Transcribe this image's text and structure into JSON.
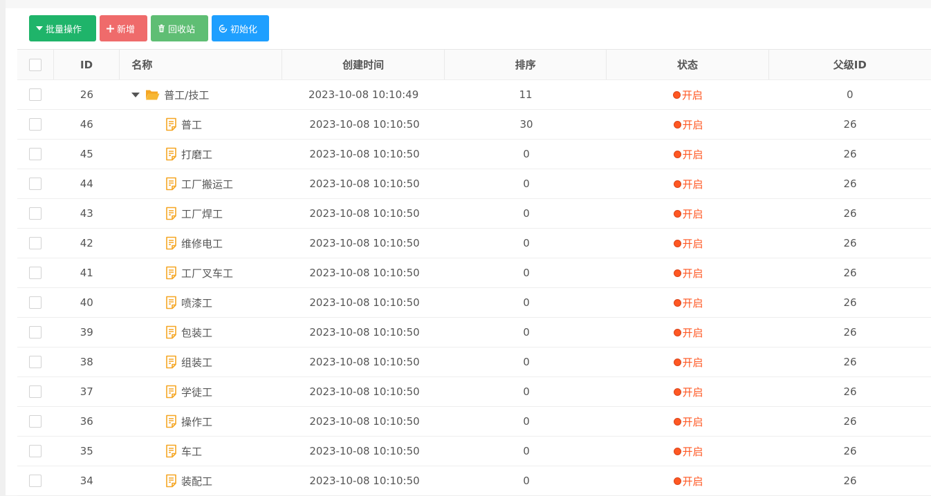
{
  "toolbar": {
    "batch_label": "批量操作",
    "add_label": "新增",
    "recycle_label": "回收站",
    "init_label": "初始化"
  },
  "table": {
    "headers": {
      "id": "ID",
      "name": "名称",
      "time": "创建时间",
      "sort": "排序",
      "status": "状态",
      "pid": "父级ID"
    },
    "rows": [
      {
        "id": "26",
        "name": "普工/技工",
        "time": "2023-10-08 10:10:49",
        "sort": "11",
        "status": "开启",
        "pid": "0",
        "type": "folder",
        "expanded": true
      },
      {
        "id": "46",
        "name": "普工",
        "time": "2023-10-08 10:10:50",
        "sort": "30",
        "status": "开启",
        "pid": "26",
        "type": "doc"
      },
      {
        "id": "45",
        "name": "打磨工",
        "time": "2023-10-08 10:10:50",
        "sort": "0",
        "status": "开启",
        "pid": "26",
        "type": "doc"
      },
      {
        "id": "44",
        "name": "工厂搬运工",
        "time": "2023-10-08 10:10:50",
        "sort": "0",
        "status": "开启",
        "pid": "26",
        "type": "doc"
      },
      {
        "id": "43",
        "name": "工厂焊工",
        "time": "2023-10-08 10:10:50",
        "sort": "0",
        "status": "开启",
        "pid": "26",
        "type": "doc"
      },
      {
        "id": "42",
        "name": "维修电工",
        "time": "2023-10-08 10:10:50",
        "sort": "0",
        "status": "开启",
        "pid": "26",
        "type": "doc"
      },
      {
        "id": "41",
        "name": "工厂叉车工",
        "time": "2023-10-08 10:10:50",
        "sort": "0",
        "status": "开启",
        "pid": "26",
        "type": "doc"
      },
      {
        "id": "40",
        "name": "喷漆工",
        "time": "2023-10-08 10:10:50",
        "sort": "0",
        "status": "开启",
        "pid": "26",
        "type": "doc"
      },
      {
        "id": "39",
        "name": "包装工",
        "time": "2023-10-08 10:10:50",
        "sort": "0",
        "status": "开启",
        "pid": "26",
        "type": "doc"
      },
      {
        "id": "38",
        "name": "组装工",
        "time": "2023-10-08 10:10:50",
        "sort": "0",
        "status": "开启",
        "pid": "26",
        "type": "doc"
      },
      {
        "id": "37",
        "name": "学徒工",
        "time": "2023-10-08 10:10:50",
        "sort": "0",
        "status": "开启",
        "pid": "26",
        "type": "doc"
      },
      {
        "id": "36",
        "name": "操作工",
        "time": "2023-10-08 10:10:50",
        "sort": "0",
        "status": "开启",
        "pid": "26",
        "type": "doc"
      },
      {
        "id": "35",
        "name": "车工",
        "time": "2023-10-08 10:10:50",
        "sort": "0",
        "status": "开启",
        "pid": "26",
        "type": "doc"
      },
      {
        "id": "34",
        "name": "装配工",
        "time": "2023-10-08 10:10:50",
        "sort": "0",
        "status": "开启",
        "pid": "26",
        "type": "doc"
      }
    ]
  },
  "colors": {
    "batch": "#1fb46a",
    "add": "#ef6b6b",
    "recycle": "#5fbe74",
    "init": "#1e9fff",
    "status": "#ff5722",
    "icon": "#f5a623"
  },
  "icons": {
    "folder": "folder-open-icon",
    "doc": "document-icon",
    "caret": "caret-down-icon"
  }
}
